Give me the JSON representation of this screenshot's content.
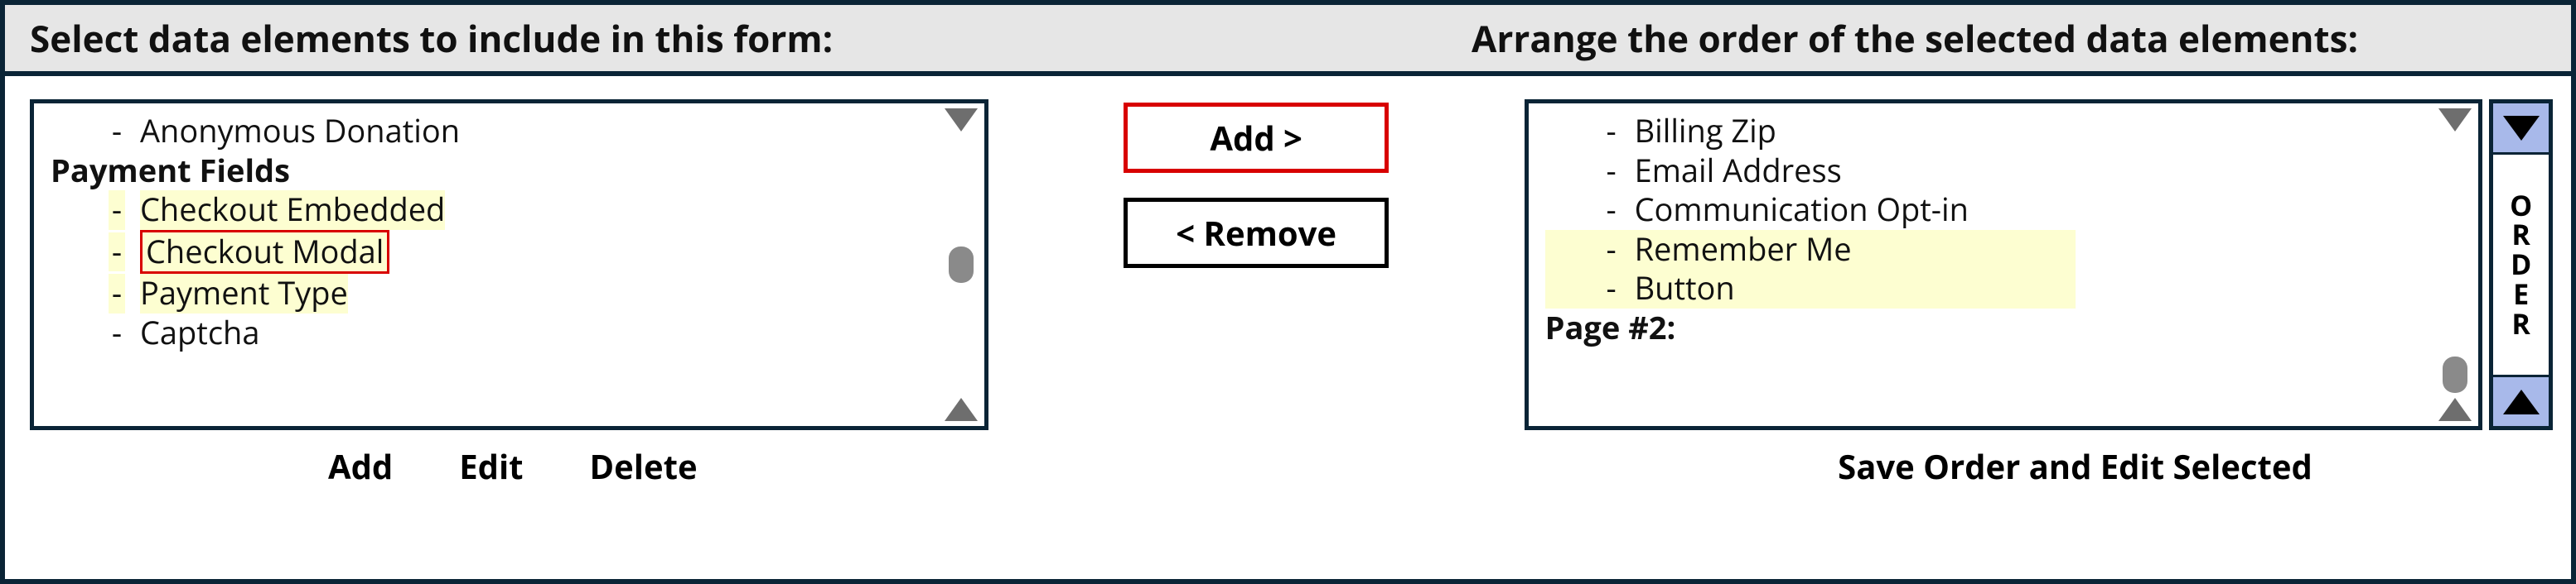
{
  "header": {
    "left": "Select data elements to include in this form:",
    "right": "Arrange the order of the selected  data elements:"
  },
  "left_list": {
    "items": [
      {
        "type": "item",
        "label": "Anonymous Donation",
        "highlight": false,
        "selected": false
      },
      {
        "type": "group",
        "label": "Payment Fields"
      },
      {
        "type": "item",
        "label": "Checkout Embedded",
        "highlight": true,
        "selected": false
      },
      {
        "type": "item",
        "label": "Checkout Modal",
        "highlight": true,
        "selected": true
      },
      {
        "type": "item",
        "label": "Payment Type",
        "highlight": true,
        "selected": false
      },
      {
        "type": "item",
        "label": "Captcha",
        "highlight": false,
        "selected": false
      }
    ],
    "thumb_position": "center"
  },
  "right_list": {
    "items": [
      {
        "type": "item",
        "label": "Billing Zip",
        "highlight": false
      },
      {
        "type": "item",
        "label": "Email Address",
        "highlight": false
      },
      {
        "type": "item",
        "label": "Communication Opt-in",
        "highlight": false
      },
      {
        "type": "item",
        "label": "Remember Me",
        "highlight": true
      },
      {
        "type": "item",
        "label": "Button",
        "highlight": true
      },
      {
        "type": "group",
        "label": "Page #2:"
      }
    ],
    "thumb_position": "flex-end"
  },
  "middle_buttons": {
    "add": "Add >",
    "remove": "< Remove"
  },
  "order": {
    "label": "ORDER"
  },
  "footer": {
    "add": "Add",
    "edit": "Edit",
    "delete": "Delete",
    "save": "Save Order and Edit Selected"
  }
}
